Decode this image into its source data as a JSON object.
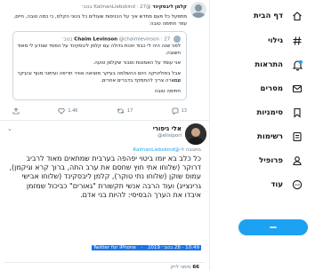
{
  "nav": {
    "items": [
      {
        "label": "דף הבית",
        "icon": "home-icon"
      },
      {
        "label": "גילוי",
        "icon": "hashtag-icon"
      },
      {
        "label": "התראות",
        "icon": "bell-icon"
      },
      {
        "label": "מסרים",
        "icon": "mail-icon"
      },
      {
        "label": "סימניות",
        "icon": "bookmark-icon"
      },
      {
        "label": "רשימות",
        "icon": "list-icon"
      },
      {
        "label": "פרופיל",
        "icon": "person-icon"
      },
      {
        "label": "עוד",
        "icon": "more-circle-icon"
      }
    ],
    "accent": "#1da1f2"
  },
  "tweet1": {
    "name": "קלמן ליבסקינד",
    "handle": "@KalmanLiebskind",
    "date": "27 בנוב׳",
    "text": "מתפעל כל פעם מחדש איך על הכניסות שעולים כל גינוני הקלס, כי כמה טובה, חיים, עפר חתימה טובה",
    "quote": {
      "name": "Chaim Levinson",
      "handle": "@chaimlevinson",
      "date": "27 בנוב׳",
      "lines": [
        "לפני שנה היה לי כבוד וזכות גדולה עם קלמן ליבסקינד על הפסד שנודע לי מאוד",
        "חשובה.",
        "אני עומד על האמונות וסבור שקלמן טועה.",
        "אבל בפוליטיקה היום ההשלמה בעיקר מוציאה אוויר חריפה ועיתוני מנוף ובעיקר עם",
        "הכשרה צריך להתמקד בדברים אחרים.",
        "חתימה טובה"
      ]
    },
    "stats": {
      "replies": "13",
      "retweets": "17",
      "likes": "1.4K"
    }
  },
  "tweet2": {
    "name": "אלי גיפורי",
    "handle": "@elisipori",
    "reply_prefix": "בתגובה ל-",
    "reply_to": "@KalmanLiebskind",
    "text": "כל כלב בא יומו ביטוי יפהפה בערבית שמתאים מאוד לרביב דרוקר (שלוחו אתי חוץ שחסם את ערב התה, ברוך קרא וגיקמן), עמוס שוקן (שלוחו נתי טוקר), קלמן ליבסקינד (שלוחו אבישי גרינצייג) ועוד הרבה אנשי תקשורת \"גאורים\" כביכול שמזמן איבדו את הערך הבסיסי: להיות בני אדם.",
    "timestamp": "10:49 · 28 בנוב׳ 2019",
    "source": "Twitter for iPhone",
    "likes_count": "66",
    "likes_label": "סימני לייק"
  }
}
